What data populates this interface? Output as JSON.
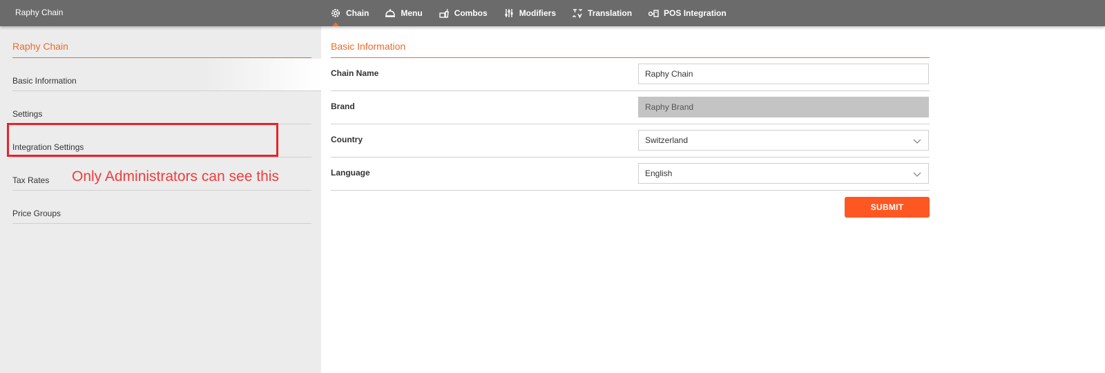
{
  "header": {
    "app_title": "Raphy Chain",
    "nav": [
      {
        "label": "Chain",
        "icon": "gear-icon",
        "active": true
      },
      {
        "label": "Menu",
        "icon": "cloche-icon"
      },
      {
        "label": "Combos",
        "icon": "combo-icon"
      },
      {
        "label": "Modifiers",
        "icon": "sliders-icon"
      },
      {
        "label": "Translation",
        "icon": "translate-icon"
      },
      {
        "label": "POS Integration",
        "icon": "pos-icon"
      }
    ]
  },
  "sidebar": {
    "title": "Raphy Chain",
    "items": [
      {
        "label": "Basic Information"
      },
      {
        "label": "Settings"
      },
      {
        "label": "Integration Settings"
      },
      {
        "label": "Tax Rates"
      },
      {
        "label": "Price Groups"
      }
    ]
  },
  "annotation": {
    "text": "Only Administrators can see this"
  },
  "main": {
    "title": "Basic Information",
    "fields": {
      "chain_name": {
        "label": "Chain Name",
        "value": "Raphy Chain"
      },
      "brand": {
        "label": "Brand",
        "value": "Raphy Brand"
      },
      "country": {
        "label": "Country",
        "value": "Switzerland"
      },
      "language": {
        "label": "Language",
        "value": "English"
      }
    },
    "submit_label": "SUBMIT"
  },
  "colors": {
    "accent": "#f06a2a",
    "button": "#ff5722",
    "topbar": "#6b6b6b",
    "sidebar": "#ececec",
    "annotation": "#e8212a"
  }
}
